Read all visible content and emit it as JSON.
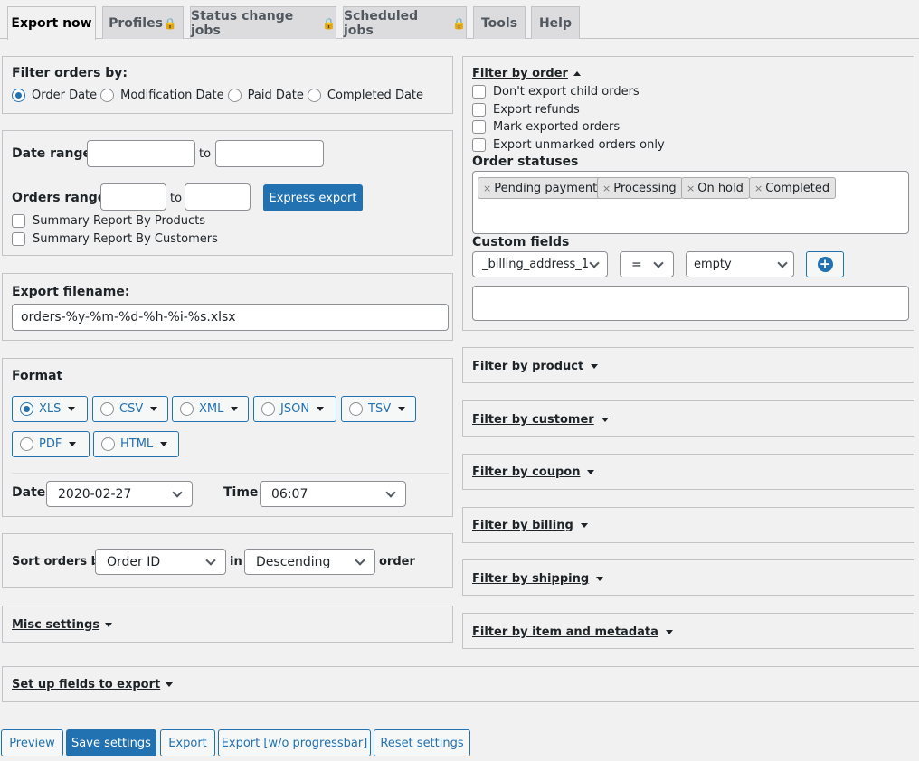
{
  "tabs": [
    {
      "label": "Export now",
      "locked": false
    },
    {
      "label": "Profiles",
      "locked": true
    },
    {
      "label": "Status change jobs",
      "locked": true
    },
    {
      "label": "Scheduled jobs",
      "locked": true
    },
    {
      "label": "Tools",
      "locked": false
    },
    {
      "label": "Help",
      "locked": false
    }
  ],
  "filter_orders_by": {
    "title": "Filter orders by:",
    "options": [
      "Order Date",
      "Modification Date",
      "Paid Date",
      "Completed Date"
    ],
    "selected": "Order Date"
  },
  "date_range": {
    "label": "Date range",
    "to": "to",
    "from_value": "",
    "to_value": ""
  },
  "orders_range": {
    "label": "Orders range",
    "to": "to",
    "from_value": "",
    "to_value": "",
    "express_export": "Express export",
    "summary_products": "Summary Report By Products",
    "summary_customers": "Summary Report By Customers"
  },
  "export_filename": {
    "label": "Export filename:",
    "value": "orders-%y-%m-%d-%h-%i-%s.xlsx"
  },
  "format": {
    "label": "Format",
    "options": [
      "XLS",
      "CSV",
      "XML",
      "JSON",
      "TSV",
      "PDF",
      "HTML"
    ],
    "selected": "XLS",
    "date_label": "Date",
    "date_value": "2020-02-27",
    "time_label": "Time",
    "time_value": "06:07"
  },
  "sort": {
    "label": "Sort orders by",
    "field": "Order ID",
    "in": "in",
    "direction": "Descending",
    "suffix": "order"
  },
  "misc_settings": "Misc settings",
  "setup_fields": "Set up fields to export",
  "filter_by_order": {
    "title": "Filter by order",
    "checkboxes": [
      "Don't export child orders",
      "Export refunds",
      "Mark exported orders",
      "Export unmarked orders only"
    ],
    "statuses_label": "Order statuses",
    "statuses": [
      "Pending payment",
      "Processing",
      "On hold",
      "Completed"
    ],
    "custom_fields_label": "Custom fields",
    "cf_field": "_billing_address_1",
    "cf_operator": "=",
    "cf_value": "empty",
    "cf_textarea": ""
  },
  "filters": [
    "Filter by product",
    "Filter by customer",
    "Filter by coupon",
    "Filter by billing",
    "Filter by shipping",
    "Filter by item and metadata"
  ],
  "buttons": {
    "preview": "Preview",
    "save": "Save settings",
    "export": "Export",
    "export_no_progress": "Export [w/o progressbar]",
    "reset": "Reset settings"
  },
  "colors": {
    "accent": "#2271b1",
    "background": "#f1f1f1",
    "lock": "#e0a030"
  }
}
